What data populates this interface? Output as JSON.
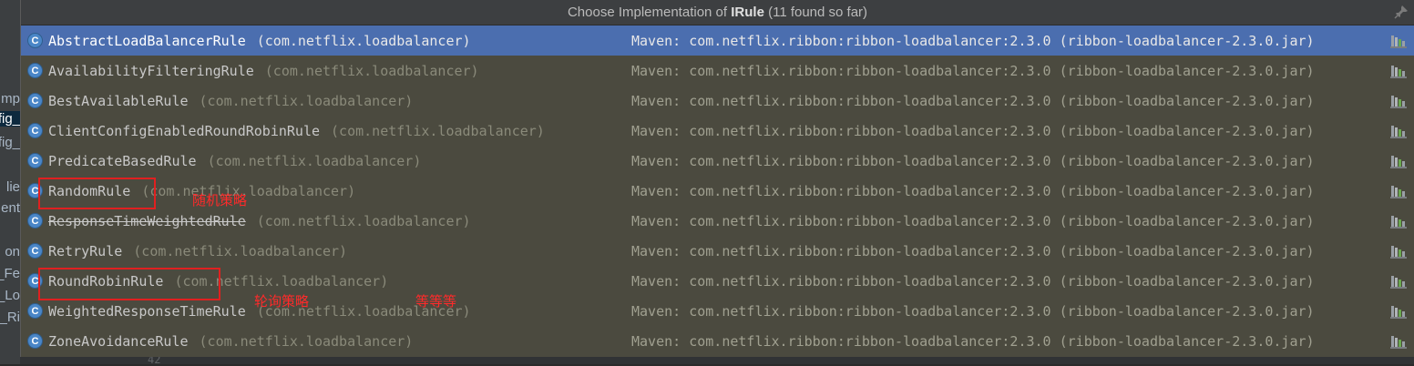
{
  "editor": {
    "left_fragments": [
      "mp",
      "fig_",
      "fig_",
      "lie",
      "ent",
      "on",
      "_Fe",
      "_Lo",
      "_Ri"
    ],
    "bottom_line_number": "42"
  },
  "popup": {
    "title_prefix": "Choose Implementation of ",
    "title_bold": "IRule",
    "title_suffix": " (11 found so far)",
    "items": [
      {
        "name": "AbstractLoadBalancerRule",
        "package": "(com.netflix.loadbalancer)",
        "source": "Maven: com.netflix.ribbon:ribbon-loadbalancer:2.3.0 (ribbon-loadbalancer-2.3.0.jar)",
        "selected": true,
        "deprecated": false
      },
      {
        "name": "AvailabilityFilteringRule",
        "package": "(com.netflix.loadbalancer)",
        "source": "Maven: com.netflix.ribbon:ribbon-loadbalancer:2.3.0 (ribbon-loadbalancer-2.3.0.jar)",
        "selected": false,
        "deprecated": false
      },
      {
        "name": "BestAvailableRule",
        "package": "(com.netflix.loadbalancer)",
        "source": "Maven: com.netflix.ribbon:ribbon-loadbalancer:2.3.0 (ribbon-loadbalancer-2.3.0.jar)",
        "selected": false,
        "deprecated": false
      },
      {
        "name": "ClientConfigEnabledRoundRobinRule",
        "package": "(com.netflix.loadbalancer)",
        "source": "Maven: com.netflix.ribbon:ribbon-loadbalancer:2.3.0 (ribbon-loadbalancer-2.3.0.jar)",
        "selected": false,
        "deprecated": false
      },
      {
        "name": "PredicateBasedRule",
        "package": "(com.netflix.loadbalancer)",
        "source": "Maven: com.netflix.ribbon:ribbon-loadbalancer:2.3.0 (ribbon-loadbalancer-2.3.0.jar)",
        "selected": false,
        "deprecated": false
      },
      {
        "name": "RandomRule",
        "package": "(com.netflix.loadbalancer)",
        "source": "Maven: com.netflix.ribbon:ribbon-loadbalancer:2.3.0 (ribbon-loadbalancer-2.3.0.jar)",
        "selected": false,
        "deprecated": false
      },
      {
        "name": "ResponseTimeWeightedRule",
        "package": "(com.netflix.loadbalancer)",
        "source": "Maven: com.netflix.ribbon:ribbon-loadbalancer:2.3.0 (ribbon-loadbalancer-2.3.0.jar)",
        "selected": false,
        "deprecated": true
      },
      {
        "name": "RetryRule",
        "package": "(com.netflix.loadbalancer)",
        "source": "Maven: com.netflix.ribbon:ribbon-loadbalancer:2.3.0 (ribbon-loadbalancer-2.3.0.jar)",
        "selected": false,
        "deprecated": false
      },
      {
        "name": "RoundRobinRule",
        "package": "(com.netflix.loadbalancer)",
        "source": "Maven: com.netflix.ribbon:ribbon-loadbalancer:2.3.0 (ribbon-loadbalancer-2.3.0.jar)",
        "selected": false,
        "deprecated": false
      },
      {
        "name": "WeightedResponseTimeRule",
        "package": "(com.netflix.loadbalancer)",
        "source": "Maven: com.netflix.ribbon:ribbon-loadbalancer:2.3.0 (ribbon-loadbalancer-2.3.0.jar)",
        "selected": false,
        "deprecated": false
      },
      {
        "name": "ZoneAvoidanceRule",
        "package": "(com.netflix.loadbalancer)",
        "source": "Maven: com.netflix.ribbon:ribbon-loadbalancer:2.3.0 (ribbon-loadbalancer-2.3.0.jar)",
        "selected": false,
        "deprecated": false
      }
    ],
    "class_icon_letter": "C",
    "row_icon": "library-jar-icon"
  },
  "annotations": {
    "random": "随机策略",
    "roundrobin": "轮询策略",
    "etc": "等等等"
  },
  "colors": {
    "selection": "#4b6eaf",
    "popup_bg": "#4b4a3f",
    "annotation": "#e02020"
  }
}
